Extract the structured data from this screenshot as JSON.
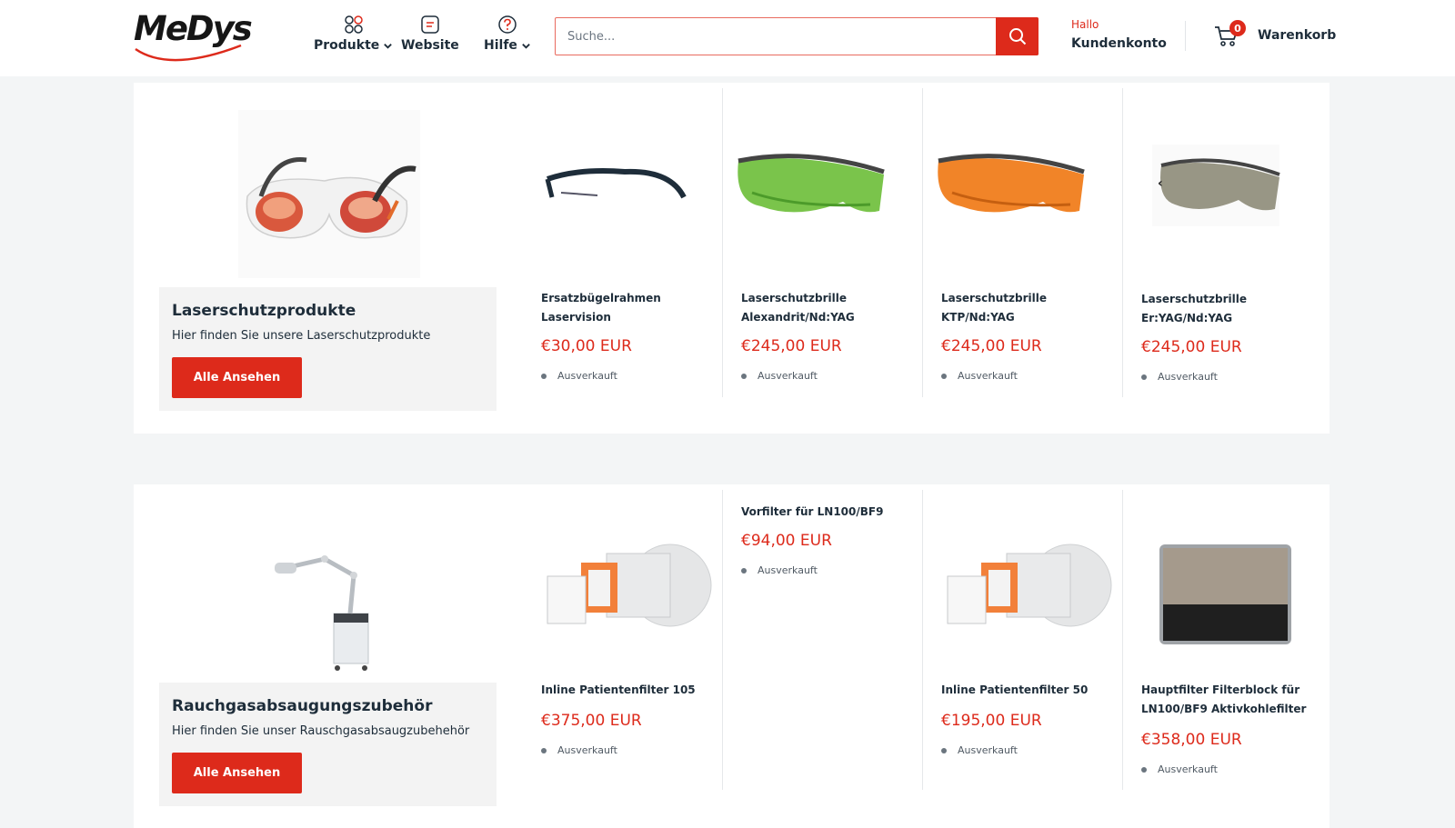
{
  "header": {
    "logo_text": "MeDys",
    "nav": [
      {
        "label": "Produkte",
        "icon": "grid-icon",
        "has_dropdown": true
      },
      {
        "label": "Website",
        "icon": "document-icon",
        "has_dropdown": false
      },
      {
        "label": "Hilfe",
        "icon": "question-icon",
        "has_dropdown": true
      }
    ],
    "search_placeholder": "Suche...",
    "account_greeting": "Hallo",
    "account_label": "Kundenkonto",
    "cart_count": "0",
    "cart_label": "Warenkorb"
  },
  "colors": {
    "accent": "#dd2a1b",
    "text": "#1e2d3a",
    "background": "#f3f5f6"
  },
  "sections": [
    {
      "title": "Laserschutzprodukte",
      "subtitle": "Hier finden Sie unsere Laserschutzprodukte",
      "button": "Alle Ansehen",
      "products": [
        {
          "title": "Ersatzbügelrahmen Laservision",
          "price": "€30,00 EUR",
          "stock": "Ausverkauft"
        },
        {
          "title": "Laserschutzbrille Alexandrit/Nd:YAG",
          "price": "€245,00 EUR",
          "stock": "Ausverkauft"
        },
        {
          "title": "Laserschutzbrille KTP/Nd:YAG",
          "price": "€245,00 EUR",
          "stock": "Ausverkauft"
        },
        {
          "title": "Laserschutzbrille Er:YAG/Nd:YAG",
          "price": "€245,00 EUR",
          "stock": "Ausverkauft"
        }
      ],
      "carousel_prev": "‹"
    },
    {
      "title": "Rauchgasabsaugungszubehör",
      "subtitle": "Hier finden Sie unser Rauschgasabsaugzubehehör",
      "button": "Alle Ansehen",
      "products": [
        {
          "title": "Inline Patientenfilter 105",
          "price": "€375,00 EUR",
          "stock": "Ausverkauft"
        },
        {
          "title": "Vorfilter für LN100/BF9",
          "price": "€94,00 EUR",
          "stock": "Ausverkauft"
        },
        {
          "title": "Inline Patientenfilter 50",
          "price": "€195,00 EUR",
          "stock": "Ausverkauft"
        },
        {
          "title": "Hauptfilter Filterblock für LN100/BF9 Aktivkohlefilter",
          "price": "€358,00 EUR",
          "stock": "Ausverkauft"
        }
      ]
    }
  ]
}
